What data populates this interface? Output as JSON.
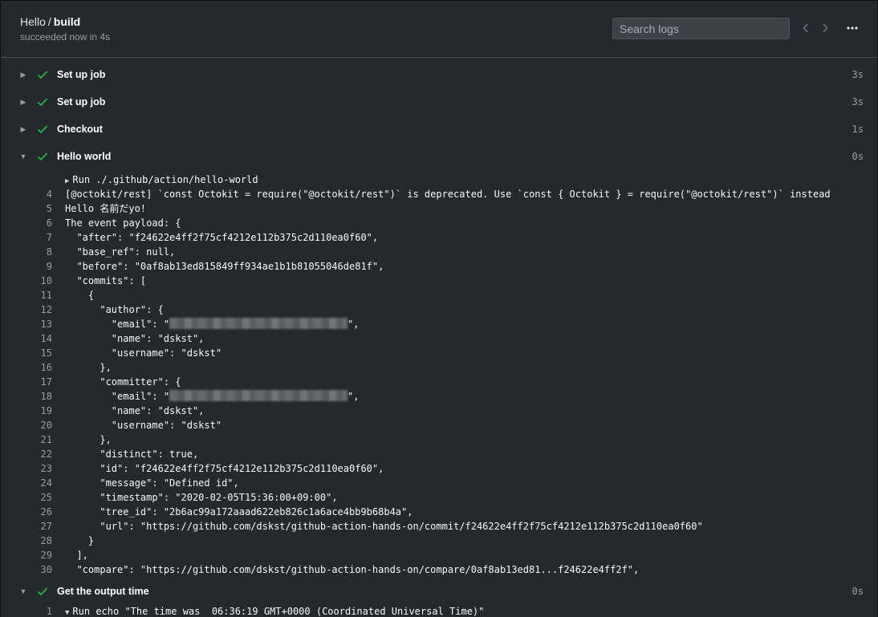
{
  "header": {
    "repo": "Hello",
    "separator": "/",
    "job": "build",
    "status": "succeeded now in 4s"
  },
  "search": {
    "placeholder": "Search logs"
  },
  "icons": {
    "prev": "chevron-left-icon",
    "next": "chevron-right-icon",
    "more": "kebab-horizontal-icon",
    "check": "check-icon",
    "collapsed": "triangle-right-icon",
    "expanded": "triangle-down-icon"
  },
  "colors": {
    "success": "#28a745",
    "background": "#24292e"
  },
  "steps": [
    {
      "name": "Set up job",
      "duration": "3s",
      "expanded": false
    },
    {
      "name": "Set up job",
      "duration": "3s",
      "expanded": false
    },
    {
      "name": "Checkout",
      "duration": "1s",
      "expanded": false
    },
    {
      "name": "Hello world",
      "duration": "0s",
      "expanded": true
    },
    {
      "name": "Get the output time",
      "duration": "0s",
      "expanded": true
    }
  ],
  "hello_world_log": [
    {
      "num": "",
      "text": "Run ./.github/action/hello-world",
      "run": true
    },
    {
      "num": "4",
      "text": "[@octokit/rest] `const Octokit = require(\"@octokit/rest\")` is deprecated. Use `const { Octokit } = require(\"@octokit/rest\")` instead"
    },
    {
      "num": "5",
      "text": "Hello 名前だyo!"
    },
    {
      "num": "6",
      "text": "The event payload: {"
    },
    {
      "num": "7",
      "text": "  \"after\": \"f24622e4ff2f75cf4212e112b375c2d110ea0f60\","
    },
    {
      "num": "8",
      "text": "  \"base_ref\": null,"
    },
    {
      "num": "9",
      "text": "  \"before\": \"0af8ab13ed815849ff934ae1b1b81055046de81f\","
    },
    {
      "num": "10",
      "text": "  \"commits\": ["
    },
    {
      "num": "11",
      "text": "    {"
    },
    {
      "num": "12",
      "text": "      \"author\": {"
    },
    {
      "num": "13",
      "text": "        \"email\": \"",
      "blur": true,
      "after": "\","
    },
    {
      "num": "14",
      "text": "        \"name\": \"dskst\","
    },
    {
      "num": "15",
      "text": "        \"username\": \"dskst\""
    },
    {
      "num": "16",
      "text": "      },"
    },
    {
      "num": "17",
      "text": "      \"committer\": {"
    },
    {
      "num": "18",
      "text": "        \"email\": \"",
      "blur": true,
      "after": "\","
    },
    {
      "num": "19",
      "text": "        \"name\": \"dskst\","
    },
    {
      "num": "20",
      "text": "        \"username\": \"dskst\""
    },
    {
      "num": "21",
      "text": "      },"
    },
    {
      "num": "22",
      "text": "      \"distinct\": true,"
    },
    {
      "num": "23",
      "text": "      \"id\": \"f24622e4ff2f75cf4212e112b375c2d110ea0f60\","
    },
    {
      "num": "24",
      "text": "      \"message\": \"Defined id\","
    },
    {
      "num": "25",
      "text": "      \"timestamp\": \"2020-02-05T15:36:00+09:00\","
    },
    {
      "num": "26",
      "text": "      \"tree_id\": \"2b6ac99a172aaad622eb826c1a6ace4bb9b68b4a\","
    },
    {
      "num": "27",
      "text": "      \"url\": \"https://github.com/dskst/github-action-hands-on/commit/f24622e4ff2f75cf4212e112b375c2d110ea0f60\""
    },
    {
      "num": "28",
      "text": "    }"
    },
    {
      "num": "29",
      "text": "  ],"
    },
    {
      "num": "30",
      "text": "  \"compare\": \"https://github.com/dskst/github-action-hands-on/compare/0af8ab13ed81...f24622e4ff2f\","
    }
  ],
  "output_time_log": [
    {
      "num": "1",
      "text": "Run echo \"The time was  06:36:19 GMT+0000 (Coordinated Universal Time)\"",
      "run": true
    }
  ]
}
